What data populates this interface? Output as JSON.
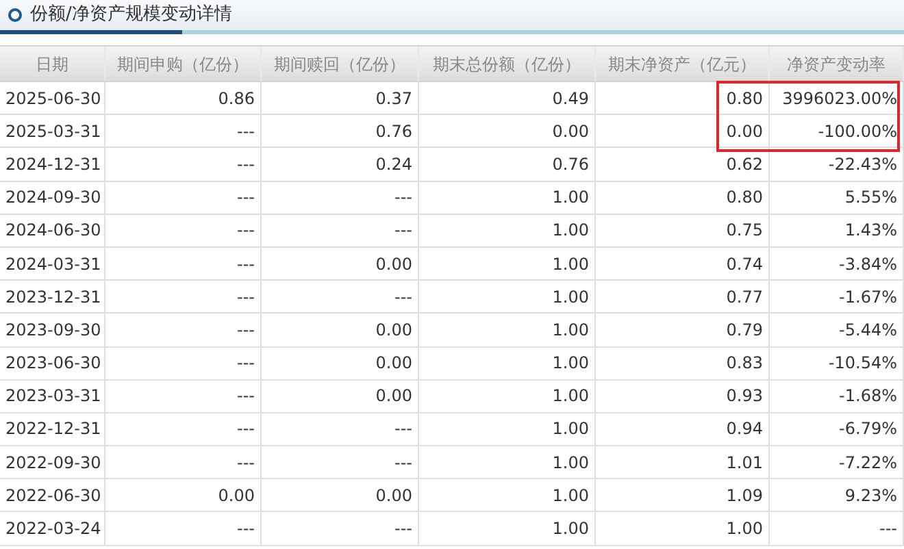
{
  "title": "份额/净资产规模变动详情",
  "table": {
    "columns": [
      "日期",
      "期间申购（亿份）",
      "期间赎回（亿份）",
      "期末总份额（亿份）",
      "期末净资产（亿元）",
      "净资产变动率"
    ],
    "rows": [
      {
        "cells": [
          "2025-06-30",
          "0.86",
          "0.37",
          "0.49",
          "0.80",
          "3996023.00%"
        ],
        "highlighted": true
      },
      {
        "cells": [
          "2025-03-31",
          "---",
          "0.76",
          "0.00",
          "0.00",
          "-100.00%"
        ],
        "highlighted": true
      },
      {
        "cells": [
          "2024-12-31",
          "---",
          "0.24",
          "0.76",
          "0.62",
          "-22.43%"
        ],
        "highlighted": false
      },
      {
        "cells": [
          "2024-09-30",
          "---",
          "---",
          "1.00",
          "0.80",
          "5.55%"
        ],
        "highlighted": false
      },
      {
        "cells": [
          "2024-06-30",
          "---",
          "---",
          "1.00",
          "0.75",
          "1.43%"
        ],
        "highlighted": false
      },
      {
        "cells": [
          "2024-03-31",
          "---",
          "0.00",
          "1.00",
          "0.74",
          "-3.84%"
        ],
        "highlighted": false
      },
      {
        "cells": [
          "2023-12-31",
          "---",
          "---",
          "1.00",
          "0.77",
          "-1.67%"
        ],
        "highlighted": false
      },
      {
        "cells": [
          "2023-09-30",
          "---",
          "0.00",
          "1.00",
          "0.79",
          "-5.44%"
        ],
        "highlighted": false
      },
      {
        "cells": [
          "2023-06-30",
          "---",
          "0.00",
          "1.00",
          "0.83",
          "-10.54%"
        ],
        "highlighted": false
      },
      {
        "cells": [
          "2023-03-31",
          "---",
          "0.00",
          "1.00",
          "0.93",
          "-1.68%"
        ],
        "highlighted": false
      },
      {
        "cells": [
          "2022-12-31",
          "---",
          "---",
          "1.00",
          "0.94",
          "-6.79%"
        ],
        "highlighted": false
      },
      {
        "cells": [
          "2022-09-30",
          "---",
          "---",
          "1.00",
          "1.01",
          "-7.22%"
        ],
        "highlighted": false
      },
      {
        "cells": [
          "2022-06-30",
          "0.00",
          "0.00",
          "1.00",
          "1.09",
          "9.23%"
        ],
        "highlighted": false
      },
      {
        "cells": [
          "2022-03-24",
          "---",
          "---",
          "1.00",
          "1.00",
          "---"
        ],
        "highlighted": false
      }
    ]
  }
}
